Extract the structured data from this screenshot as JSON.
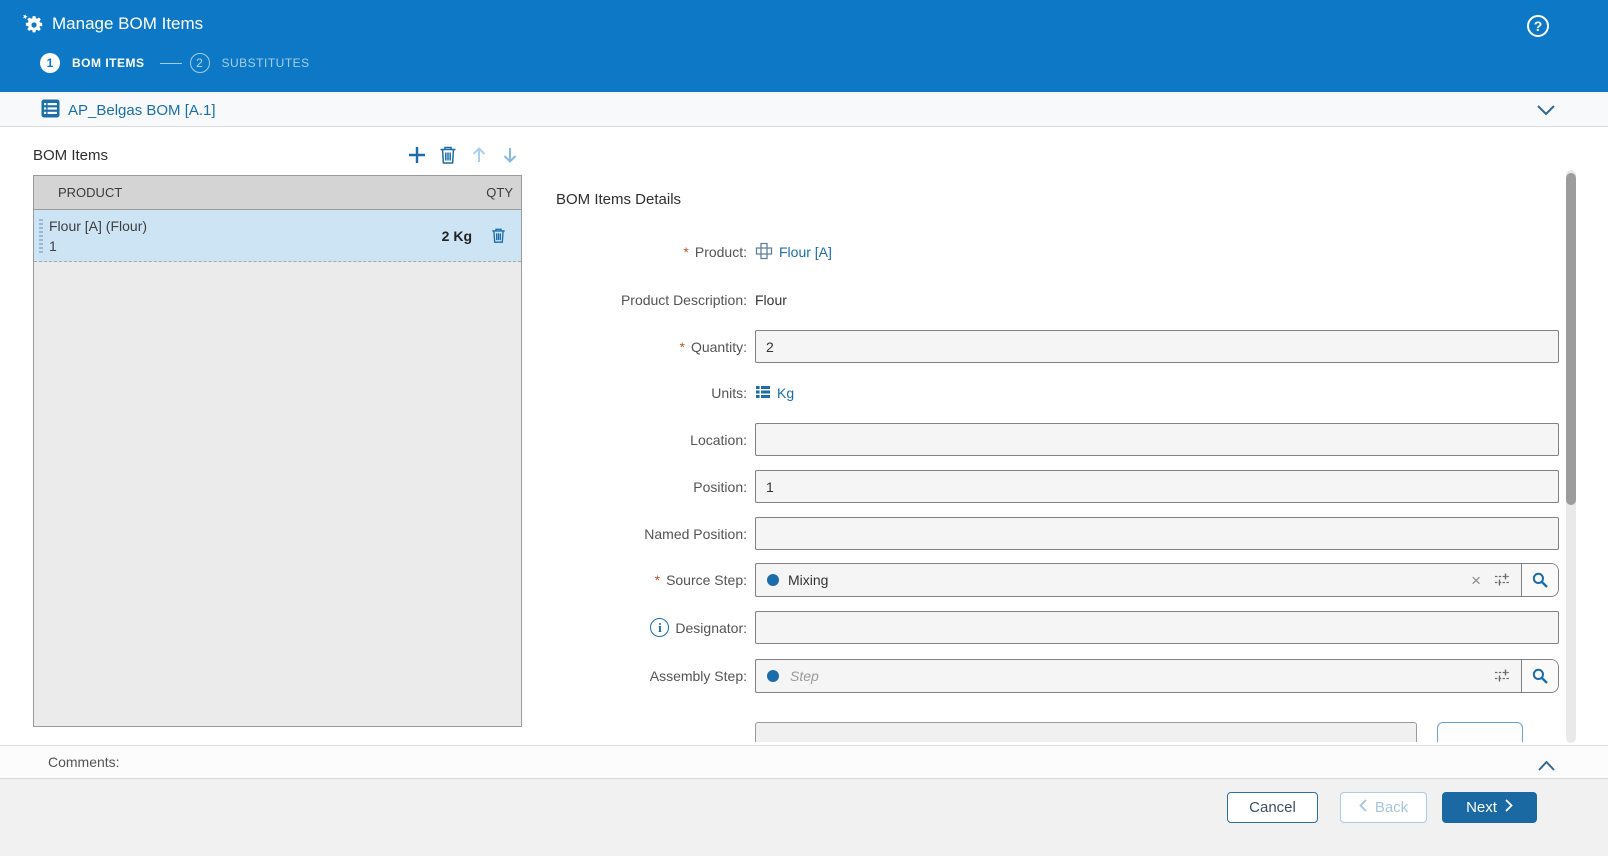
{
  "ui": {
    "required_marker": "*"
  },
  "header": {
    "title": "Manage BOM Items",
    "help_glyph": "?",
    "steps": [
      {
        "number": "1",
        "label": "BOM ITEMS"
      },
      {
        "number": "2",
        "label": "SUBSTITUTES"
      }
    ]
  },
  "context_bar": {
    "title": "AP_Belgas BOM [A.1]"
  },
  "bom_list": {
    "title": "BOM Items",
    "columns": {
      "product": "PRODUCT",
      "qty": "QTY"
    },
    "rows": [
      {
        "name": "Flour [A] (Flour)",
        "position": "1",
        "qty": "2 Kg"
      }
    ]
  },
  "details": {
    "title": "BOM Items Details",
    "product_label": "Product:",
    "product_value": "Flour [A]",
    "product_description_label": "Product Description:",
    "product_description_value": "Flour",
    "quantity_label": "Quantity:",
    "quantity_value": "2",
    "units_label": "Units:",
    "units_value": "Kg",
    "location_label": "Location:",
    "location_value": "",
    "position_label": "Position:",
    "position_value": "1",
    "named_position_label": "Named Position:",
    "named_position_value": "",
    "source_step_label": "Source Step:",
    "source_step_value": "Mixing",
    "designator_label": "Designator:",
    "designator_value": "",
    "info_glyph": "i",
    "clear_glyph": "×",
    "assembly_step_label": "Assembly Step:",
    "assembly_step_placeholder": "Step"
  },
  "comments": {
    "label": "Comments:"
  },
  "footer": {
    "cancel_label": "Cancel",
    "back_label": "Back",
    "next_label": "Next"
  },
  "colors": {
    "header_blue": "#0d79c6",
    "link_blue": "#1a6fa8",
    "selected_row_blue": "#cde4f4",
    "next_button_blue": "#1a69a2",
    "required_orange": "#b35a28"
  }
}
